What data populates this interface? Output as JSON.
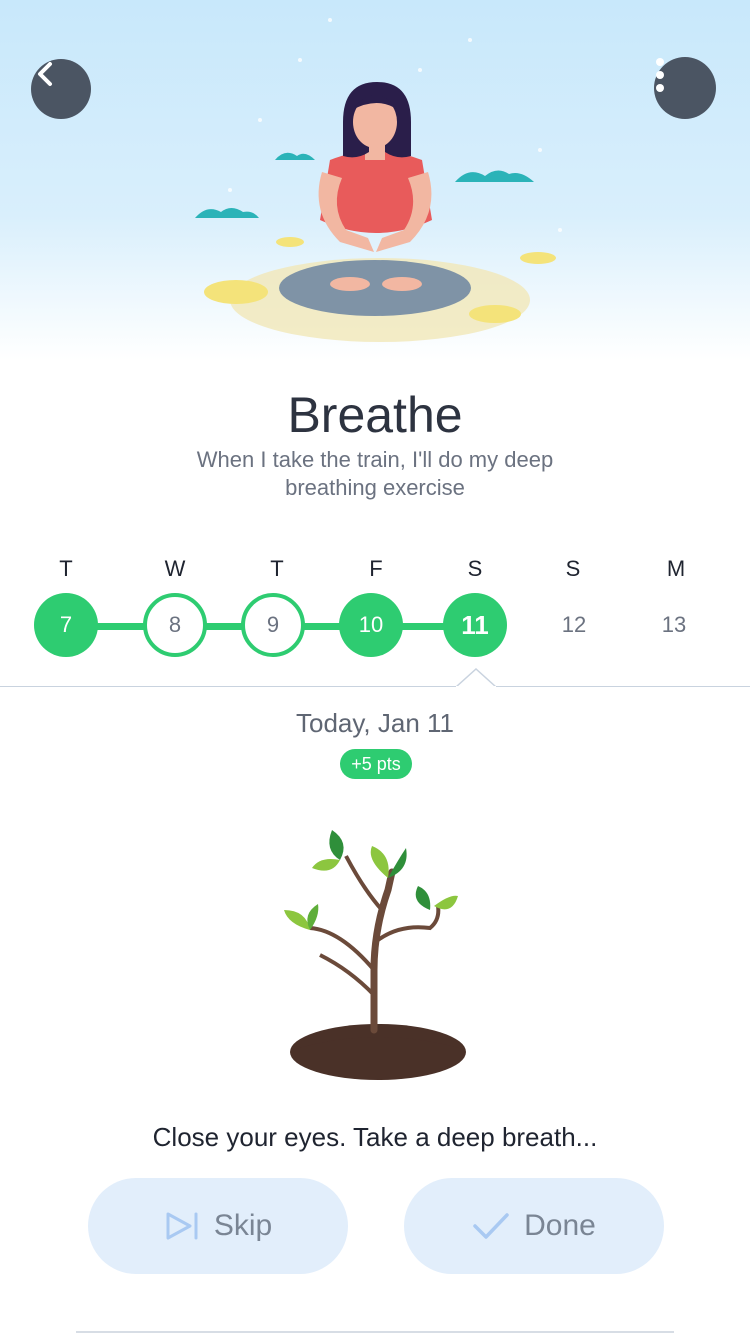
{
  "header": {
    "back_icon": "chevron-left-icon",
    "more_icon": "vertical-dots-icon"
  },
  "habit": {
    "title": "Breathe",
    "subtitle": "When I take the train, I'll do my deep breathing exercise"
  },
  "week": {
    "days": [
      {
        "letter": "T",
        "date": "7",
        "state": "done"
      },
      {
        "letter": "W",
        "date": "8",
        "state": "skipped"
      },
      {
        "letter": "T",
        "date": "9",
        "state": "skipped"
      },
      {
        "letter": "F",
        "date": "10",
        "state": "done"
      },
      {
        "letter": "S",
        "date": "11",
        "state": "today"
      },
      {
        "letter": "S",
        "date": "12",
        "state": "future"
      },
      {
        "letter": "M",
        "date": "13",
        "state": "future"
      }
    ]
  },
  "today": {
    "label": "Today, Jan 11",
    "points": "+5 pts"
  },
  "instruction": "Close your eyes. Take a deep breath...",
  "actions": {
    "skip_label": "Skip",
    "skip_icon": "skip-icon",
    "done_label": "Done",
    "done_icon": "checkmark-icon"
  },
  "colors": {
    "accent_green": "#2ecc71",
    "button_bg": "#e2eefb",
    "header_btn": "#4b5563"
  }
}
